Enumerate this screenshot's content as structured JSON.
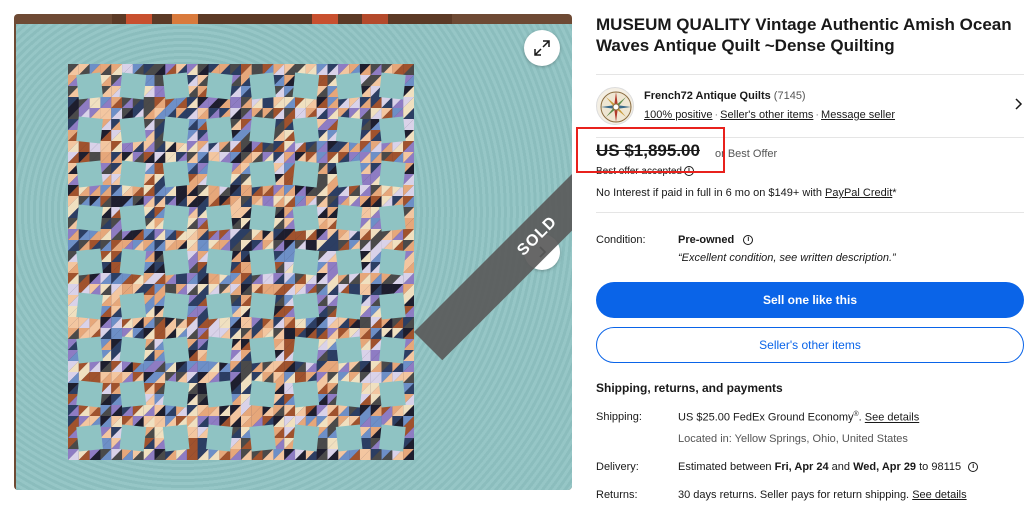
{
  "listing": {
    "title": "MUSEUM QUALITY Vintage Authentic Amish Ocean Waves Antique Quilt ~Dense Quilting"
  },
  "gallery": {
    "sold_label": "SOLD",
    "expand_icon": "expand-icon",
    "next_icon": "chevron-right-icon"
  },
  "seller": {
    "name": "French72 Antique Quilts",
    "feedback_count": "(7145)",
    "positive": "100% positive",
    "other_items": "Seller's other items",
    "message": "Message seller"
  },
  "price": {
    "amount": "US $1,895.00",
    "or_best_offer": "or Best Offer",
    "best_offer_accepted": "Best offer accepted",
    "financing_text": "No Interest if paid in full in 6 mo on $149+ with ",
    "financing_link": "PayPal Credit",
    "financing_suffix": "*"
  },
  "condition": {
    "label": "Condition:",
    "value": "Pre-owned",
    "description": "“Excellent condition, see written description.”"
  },
  "buttons": {
    "sell_one": "Sell one like this",
    "seller_other_items": "Seller's other items"
  },
  "shipping": {
    "section_title": "Shipping, returns, and payments",
    "shipping_label": "Shipping:",
    "shipping_cost": "US $25.00",
    "shipping_service": " FedEx Ground Economy",
    "shipping_reg": "®",
    "see_details": "See details",
    "location": "Located in: Yellow Springs, Ohio, United States",
    "delivery_label": "Delivery:",
    "delivery_prefix": "Estimated between ",
    "delivery_start": "Fri, Apr 24",
    "delivery_and": " and ",
    "delivery_end": "Wed, Apr 29",
    "delivery_suffix": " to 98115",
    "returns_label": "Returns:",
    "returns_text": "30 days returns. Seller pays for return shipping. ",
    "returns_link": "See details"
  },
  "colors": {
    "primary_blue": "#0a64e8",
    "highlight_red": "#e8211c",
    "quilt_teal": "#8fc3c3"
  }
}
